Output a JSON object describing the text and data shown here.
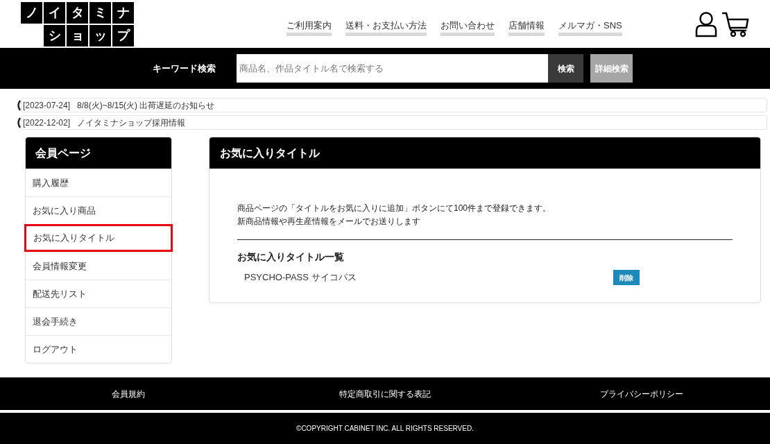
{
  "logo": {
    "rows": [
      [
        "ノ",
        "イ",
        "タ",
        "ミ",
        "ナ"
      ],
      [
        "",
        "シ",
        "ョ",
        "ッ",
        "プ"
      ]
    ]
  },
  "nav": [
    "ご利用案内",
    "送料・お支払い方法",
    "お問い合わせ",
    "店舗情報",
    "メルマガ・SNS"
  ],
  "search": {
    "label": "キーワード検索",
    "placeholder": "商品名、作品タイトル名で検索する",
    "button": "検索",
    "advanced": "詳細検索"
  },
  "notices": [
    {
      "date": "[2023-07-24]",
      "title": "8/8(火)~8/15(火) 出荷遅延のお知らせ"
    },
    {
      "date": "[2022-12-02]",
      "title": "ノイタミナショップ採用情報"
    }
  ],
  "sidebar": {
    "title": "会員ページ",
    "items": [
      {
        "label": "購入履歴",
        "selected": false
      },
      {
        "label": "お気に入り商品",
        "selected": false
      },
      {
        "label": "お気に入りタイトル",
        "selected": true
      },
      {
        "label": "会員情報変更",
        "selected": false
      },
      {
        "label": "配送先リスト",
        "selected": false
      },
      {
        "label": "退会手続き",
        "selected": false
      },
      {
        "label": "ログアウト",
        "selected": false
      }
    ]
  },
  "main": {
    "title": "お気に入りタイトル",
    "description": [
      "商品ページの「タイトルをお気に入りに追加」ボタンにて100件まで登録できます。",
      "新商品情報や再生産情報をメールでお送りします"
    ],
    "list_title": "お気に入りタイトル一覧",
    "rows": [
      {
        "title": "PSYCHO-PASS サイコパス",
        "action": "削除"
      }
    ]
  },
  "footer": {
    "links": [
      "会員規約",
      "特定商取引に関する表記",
      "プライバシーポリシー"
    ],
    "copyright": "©COPYRIGHT CABINET INC. ALL RIGHTS RESERVED."
  }
}
